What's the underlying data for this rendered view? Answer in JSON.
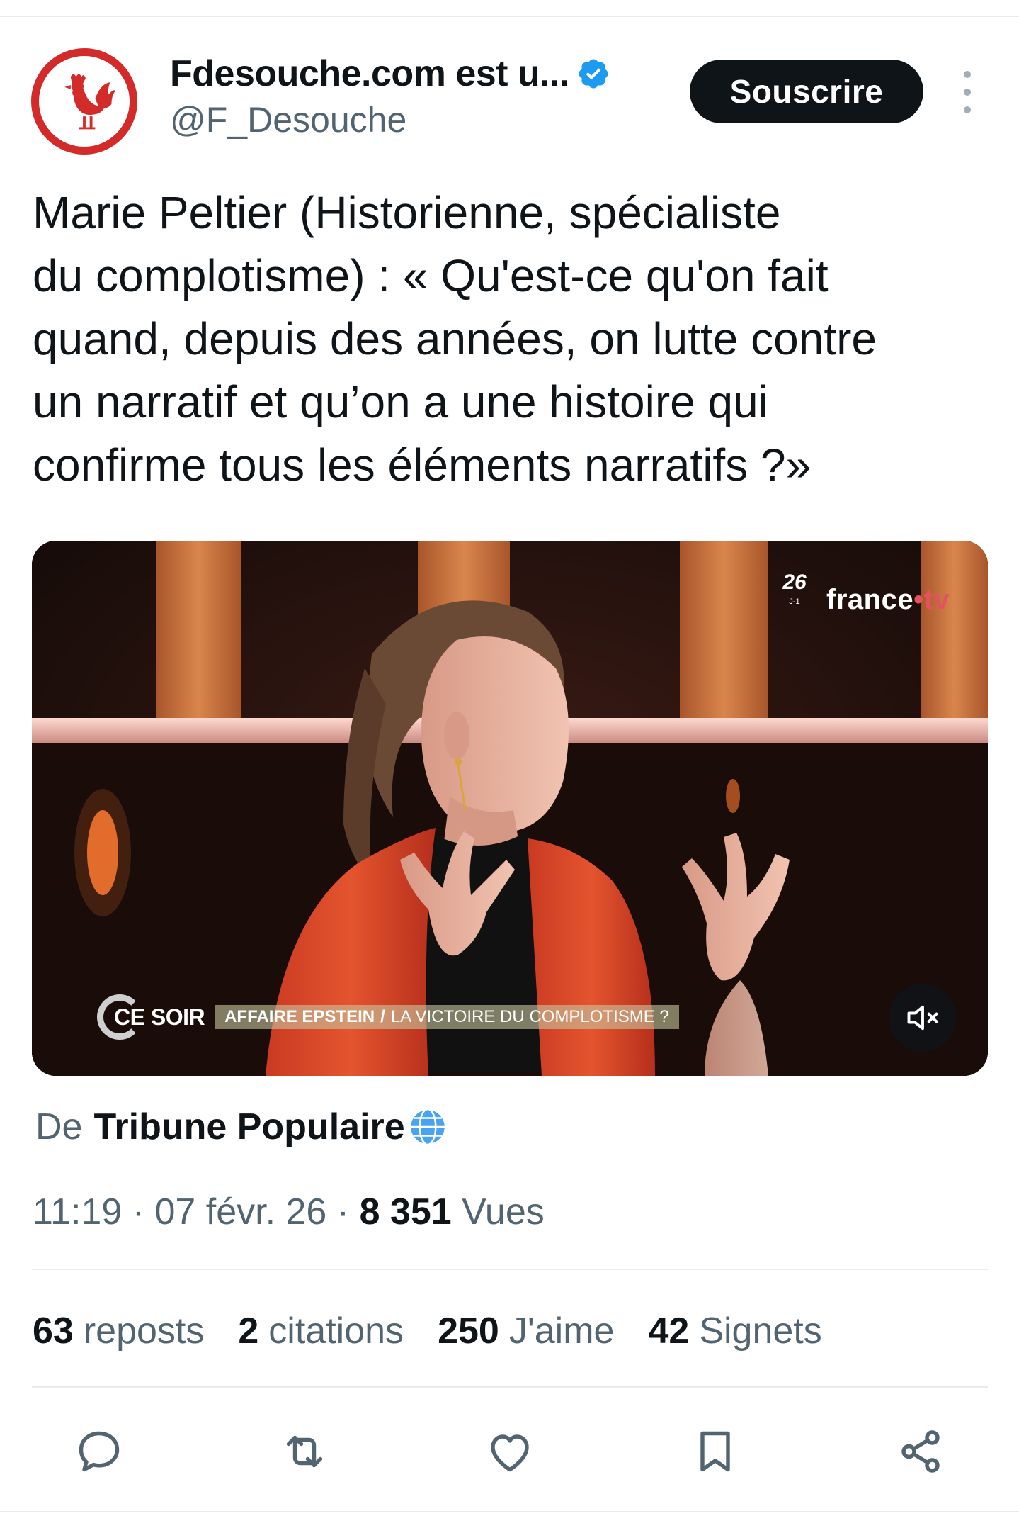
{
  "author": {
    "name": "Fdesouche.com est u...",
    "handle": "@F_Desouche",
    "avatar_icon": "rooster-icon",
    "verified_color": "#1d9bf0"
  },
  "header": {
    "subscribe_label": "Souscrire"
  },
  "tweet": {
    "text": "Marie Peltier (Historienne, spécialiste\ndu complotisme) : « Qu'est-ce qu'on fait\nquand, depuis des années, on lutte contre\nun narratif et qu’on a une histoire qui\nconfirme tous les éléments narratifs ?»"
  },
  "media": {
    "channel_name": "france",
    "channel_dot": "•",
    "channel_suffix": "tv",
    "olympic_mark": "26",
    "olympic_caption": "J-1",
    "show_name": "CE SOIR",
    "headline_main": "AFFAIRE EPSTEIN",
    "headline_sep": "/",
    "headline_sub": "LA VICTOIRE DU COMPLOTISME ?",
    "mute_icon": "speaker-muted-icon"
  },
  "source": {
    "prefix": "De",
    "name": "Tribune Populaire",
    "icon": "globe-icon"
  },
  "meta": {
    "time": "11:19",
    "separator": " · ",
    "date": "07 févr. 26",
    "views_count": "8 351",
    "views_label": " Vues"
  },
  "stats": [
    {
      "count": "63",
      "label": "reposts"
    },
    {
      "count": "2",
      "label": "citations"
    },
    {
      "count": "250",
      "label": "J'aime"
    },
    {
      "count": "42",
      "label": "Signets"
    }
  ],
  "actions": [
    "reply-icon",
    "repost-icon",
    "like-icon",
    "bookmark-icon",
    "share-icon"
  ],
  "colors": {
    "text_primary": "#0f1419",
    "text_secondary": "#536471",
    "avatar_ring": "#d32a2a",
    "button_bg": "#0f1419"
  }
}
